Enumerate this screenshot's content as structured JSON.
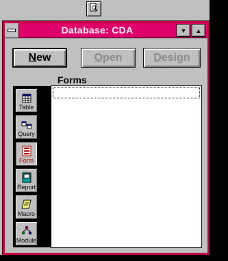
{
  "window": {
    "title": "Database: CDA",
    "icons": {
      "sysmenu": "system-menu-icon",
      "minimize": "minimize-icon",
      "maximize": "maximize-icon"
    }
  },
  "toolbar": {
    "icon": "print-preview-icon"
  },
  "commands": {
    "new": {
      "mnemonic": "N",
      "rest": "ew",
      "enabled": true
    },
    "open": {
      "mnemonic": "O",
      "rest": "pen",
      "enabled": false
    },
    "design": {
      "mnemonic": "D",
      "rest": "esign",
      "enabled": false
    }
  },
  "section": {
    "label": "Forms"
  },
  "object_tabs": [
    {
      "label": "Table",
      "icon": "table-icon",
      "active": false
    },
    {
      "label": "Query",
      "icon": "query-icon",
      "active": false
    },
    {
      "label": "Form",
      "icon": "form-icon",
      "active": true
    },
    {
      "label": "Report",
      "icon": "report-icon",
      "active": false
    },
    {
      "label": "Macro",
      "icon": "macro-icon",
      "active": false
    },
    {
      "label": "Module",
      "icon": "module-icon",
      "active": false
    }
  ],
  "list": {
    "items": []
  },
  "colors": {
    "title_bar": "#e0006a",
    "window_border": "#c80048",
    "face": "#c0c0c0",
    "active_tab_text": "#b00000"
  }
}
